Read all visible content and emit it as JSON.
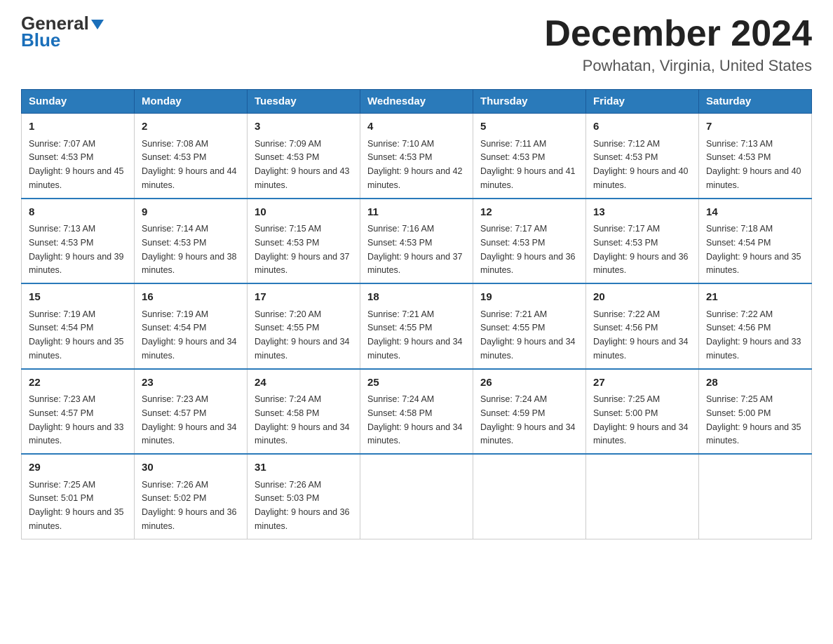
{
  "header": {
    "logo": {
      "general": "General",
      "blue": "Blue"
    },
    "title": "December 2024",
    "location": "Powhatan, Virginia, United States"
  },
  "calendar": {
    "days_of_week": [
      "Sunday",
      "Monday",
      "Tuesday",
      "Wednesday",
      "Thursday",
      "Friday",
      "Saturday"
    ],
    "weeks": [
      [
        {
          "day": "1",
          "sunrise": "7:07 AM",
          "sunset": "4:53 PM",
          "daylight": "9 hours and 45 minutes."
        },
        {
          "day": "2",
          "sunrise": "7:08 AM",
          "sunset": "4:53 PM",
          "daylight": "9 hours and 44 minutes."
        },
        {
          "day": "3",
          "sunrise": "7:09 AM",
          "sunset": "4:53 PM",
          "daylight": "9 hours and 43 minutes."
        },
        {
          "day": "4",
          "sunrise": "7:10 AM",
          "sunset": "4:53 PM",
          "daylight": "9 hours and 42 minutes."
        },
        {
          "day": "5",
          "sunrise": "7:11 AM",
          "sunset": "4:53 PM",
          "daylight": "9 hours and 41 minutes."
        },
        {
          "day": "6",
          "sunrise": "7:12 AM",
          "sunset": "4:53 PM",
          "daylight": "9 hours and 40 minutes."
        },
        {
          "day": "7",
          "sunrise": "7:13 AM",
          "sunset": "4:53 PM",
          "daylight": "9 hours and 40 minutes."
        }
      ],
      [
        {
          "day": "8",
          "sunrise": "7:13 AM",
          "sunset": "4:53 PM",
          "daylight": "9 hours and 39 minutes."
        },
        {
          "day": "9",
          "sunrise": "7:14 AM",
          "sunset": "4:53 PM",
          "daylight": "9 hours and 38 minutes."
        },
        {
          "day": "10",
          "sunrise": "7:15 AM",
          "sunset": "4:53 PM",
          "daylight": "9 hours and 37 minutes."
        },
        {
          "day": "11",
          "sunrise": "7:16 AM",
          "sunset": "4:53 PM",
          "daylight": "9 hours and 37 minutes."
        },
        {
          "day": "12",
          "sunrise": "7:17 AM",
          "sunset": "4:53 PM",
          "daylight": "9 hours and 36 minutes."
        },
        {
          "day": "13",
          "sunrise": "7:17 AM",
          "sunset": "4:53 PM",
          "daylight": "9 hours and 36 minutes."
        },
        {
          "day": "14",
          "sunrise": "7:18 AM",
          "sunset": "4:54 PM",
          "daylight": "9 hours and 35 minutes."
        }
      ],
      [
        {
          "day": "15",
          "sunrise": "7:19 AM",
          "sunset": "4:54 PM",
          "daylight": "9 hours and 35 minutes."
        },
        {
          "day": "16",
          "sunrise": "7:19 AM",
          "sunset": "4:54 PM",
          "daylight": "9 hours and 34 minutes."
        },
        {
          "day": "17",
          "sunrise": "7:20 AM",
          "sunset": "4:55 PM",
          "daylight": "9 hours and 34 minutes."
        },
        {
          "day": "18",
          "sunrise": "7:21 AM",
          "sunset": "4:55 PM",
          "daylight": "9 hours and 34 minutes."
        },
        {
          "day": "19",
          "sunrise": "7:21 AM",
          "sunset": "4:55 PM",
          "daylight": "9 hours and 34 minutes."
        },
        {
          "day": "20",
          "sunrise": "7:22 AM",
          "sunset": "4:56 PM",
          "daylight": "9 hours and 34 minutes."
        },
        {
          "day": "21",
          "sunrise": "7:22 AM",
          "sunset": "4:56 PM",
          "daylight": "9 hours and 33 minutes."
        }
      ],
      [
        {
          "day": "22",
          "sunrise": "7:23 AM",
          "sunset": "4:57 PM",
          "daylight": "9 hours and 33 minutes."
        },
        {
          "day": "23",
          "sunrise": "7:23 AM",
          "sunset": "4:57 PM",
          "daylight": "9 hours and 34 minutes."
        },
        {
          "day": "24",
          "sunrise": "7:24 AM",
          "sunset": "4:58 PM",
          "daylight": "9 hours and 34 minutes."
        },
        {
          "day": "25",
          "sunrise": "7:24 AM",
          "sunset": "4:58 PM",
          "daylight": "9 hours and 34 minutes."
        },
        {
          "day": "26",
          "sunrise": "7:24 AM",
          "sunset": "4:59 PM",
          "daylight": "9 hours and 34 minutes."
        },
        {
          "day": "27",
          "sunrise": "7:25 AM",
          "sunset": "5:00 PM",
          "daylight": "9 hours and 34 minutes."
        },
        {
          "day": "28",
          "sunrise": "7:25 AM",
          "sunset": "5:00 PM",
          "daylight": "9 hours and 35 minutes."
        }
      ],
      [
        {
          "day": "29",
          "sunrise": "7:25 AM",
          "sunset": "5:01 PM",
          "daylight": "9 hours and 35 minutes."
        },
        {
          "day": "30",
          "sunrise": "7:26 AM",
          "sunset": "5:02 PM",
          "daylight": "9 hours and 36 minutes."
        },
        {
          "day": "31",
          "sunrise": "7:26 AM",
          "sunset": "5:03 PM",
          "daylight": "9 hours and 36 minutes."
        },
        null,
        null,
        null,
        null
      ]
    ]
  }
}
